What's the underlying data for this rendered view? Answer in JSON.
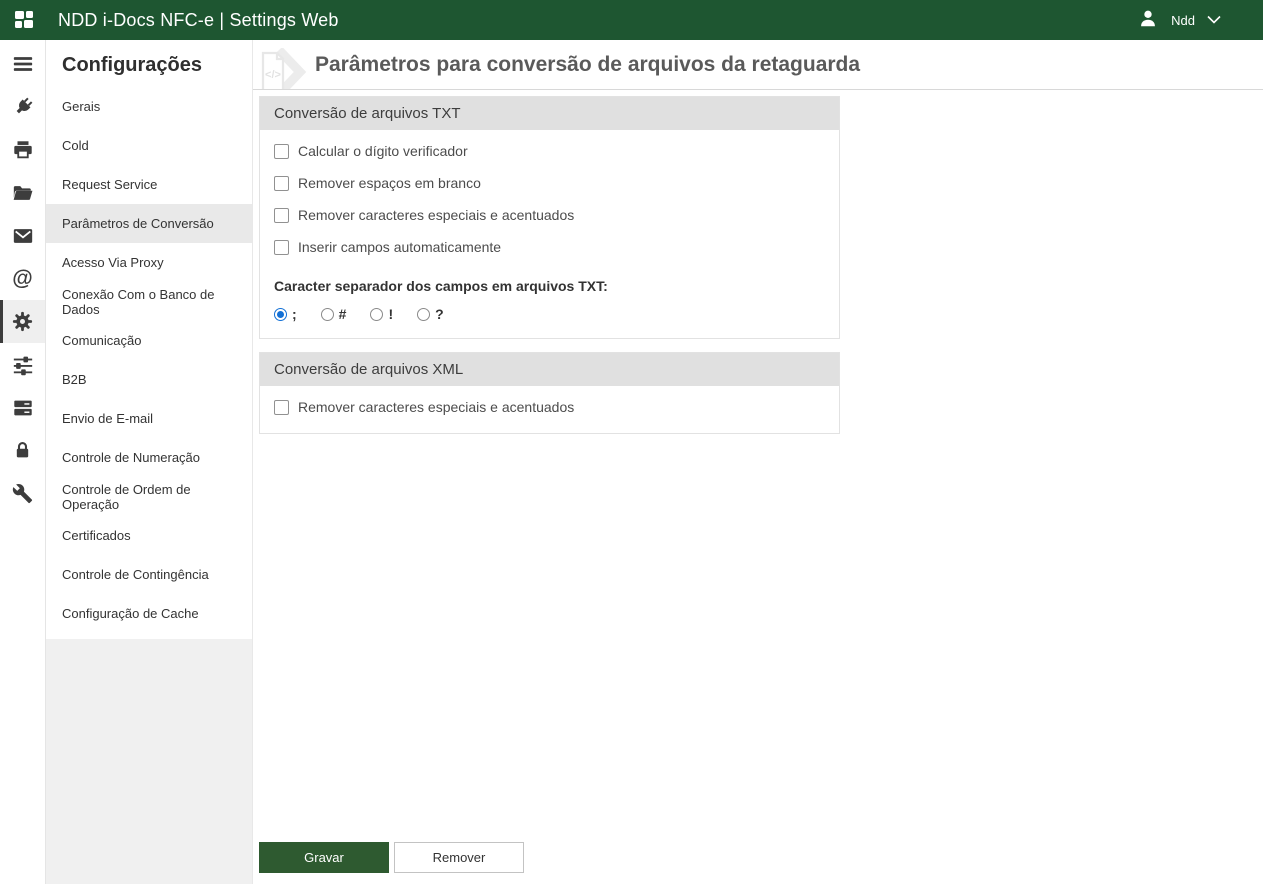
{
  "colors": {
    "topbar_bg": "#1e5631",
    "save_button_bg": "#2e5a30",
    "radio_accent": "#1270d6",
    "selected_nav_bg": "#e9e9e9",
    "rail_selected_border": "#3c3c3c"
  },
  "topbar": {
    "title": "NDD i-Docs NFC-e | Settings Web",
    "user_name": "Ndd"
  },
  "icon_rail": {
    "items": [
      {
        "name": "menu",
        "selected": false
      },
      {
        "name": "plug",
        "selected": false
      },
      {
        "name": "printer",
        "selected": false
      },
      {
        "name": "folder-open",
        "selected": false
      },
      {
        "name": "envelope",
        "selected": false
      },
      {
        "name": "at-sign",
        "selected": false
      },
      {
        "name": "gear",
        "selected": true
      },
      {
        "name": "sliders",
        "selected": false
      },
      {
        "name": "server",
        "selected": false
      },
      {
        "name": "lock",
        "selected": false
      },
      {
        "name": "wrench",
        "selected": false
      }
    ]
  },
  "sidebar": {
    "heading": "Configurações",
    "items": [
      {
        "label": "Gerais",
        "selected": false
      },
      {
        "label": "Cold",
        "selected": false
      },
      {
        "label": "Request Service",
        "selected": false
      },
      {
        "label": "Parâmetros de Conversão",
        "selected": true
      },
      {
        "label": "Acesso Via Proxy",
        "selected": false
      },
      {
        "label": "Conexão Com o Banco de Dados",
        "selected": false
      },
      {
        "label": "Comunicação",
        "selected": false
      },
      {
        "label": "B2B",
        "selected": false
      },
      {
        "label": "Envio de E-mail",
        "selected": false
      },
      {
        "label": "Controle de Numeração",
        "selected": false
      },
      {
        "label": "Controle de Ordem de Operação",
        "selected": false
      },
      {
        "label": "Certificados",
        "selected": false
      },
      {
        "label": "Controle de Contingência",
        "selected": false
      },
      {
        "label": "Configuração de Cache",
        "selected": false
      }
    ]
  },
  "main": {
    "page_title": "Parâmetros para conversão de arquivos da retaguarda",
    "panels": [
      {
        "title": "Conversão de arquivos TXT",
        "checkboxes": [
          {
            "label": "Calcular o dígito verificador",
            "checked": false
          },
          {
            "label": "Remover espaços em branco",
            "checked": false
          },
          {
            "label": "Remover caracteres especiais e acentuados",
            "checked": false
          },
          {
            "label": "Inserir campos automaticamente",
            "checked": false
          }
        ],
        "separator_label": "Caracter separador dos campos em arquivos TXT:",
        "radios": [
          {
            "label": ";",
            "selected": true
          },
          {
            "label": "#",
            "selected": false
          },
          {
            "label": "!",
            "selected": false
          },
          {
            "label": "?",
            "selected": false
          }
        ]
      },
      {
        "title": "Conversão de arquivos XML",
        "checkboxes": [
          {
            "label": "Remover caracteres especiais e acentuados",
            "checked": false
          }
        ]
      }
    ],
    "footer_buttons": {
      "save": "Gravar",
      "remove": "Remover"
    }
  }
}
